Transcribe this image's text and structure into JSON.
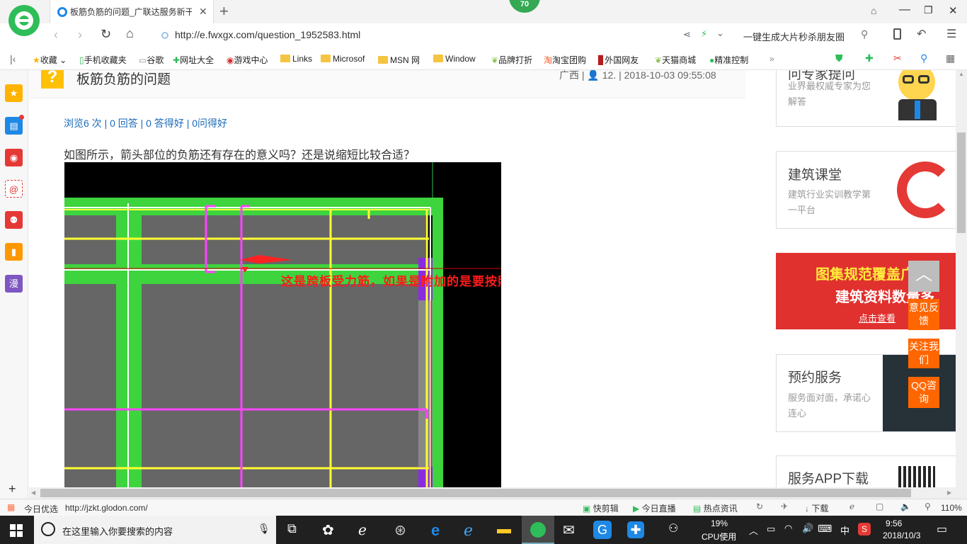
{
  "browser": {
    "tab_title": "板筋负筋的问题_广联达服务新干",
    "badge": "70",
    "url": "http://e.fwxgx.com/question_1952583.html",
    "search_hint": "一键生成大片秒杀朋友圈",
    "bookmarks": [
      "收藏",
      "手机收藏夹",
      "谷歌",
      "网址大全",
      "游戏中心",
      "Links",
      "Microsof",
      "MSN 网",
      "Window",
      "品牌打折",
      "淘宝团购",
      "外国网友",
      "天猫商城",
      "精准控制"
    ]
  },
  "sidebar_left": {
    "comic_label": "漫"
  },
  "question": {
    "title": "板筋负筋的问题",
    "region": "广西",
    "user": "12.",
    "datetime": "2018-10-03 09:55:08",
    "stats": "浏览6 次 | 0 回答 | 0 答得好 | 0问得好",
    "body": "如图所示，箭头部位的负筋还有存在的意义吗？还是说缩短比较合适？",
    "annotation": "这是跨板受力筋，如果是附加的是要按照图纸附加设置的"
  },
  "right_panel": {
    "card1": {
      "title": "问专家提问",
      "sub": "业界最权威专家为您解答"
    },
    "card2": {
      "title": "建筑课堂",
      "sub": "建筑行业实训教学第一平台"
    },
    "banner": {
      "line1": "图集规范覆盖广",
      "line2": "建筑资料数量多",
      "link": "点击查看"
    },
    "card3": {
      "title": "预约服务",
      "sub": "服务面对面，承诺心连心"
    },
    "card4": {
      "title": "服务APP下载"
    }
  },
  "float_buttons": [
    "意见反馈",
    "关注我们",
    "QQ咨询"
  ],
  "statusbar": {
    "left": "今日优选",
    "url": "http://jzkt.glodon.com/",
    "items": [
      "快剪辑",
      "今日直播",
      "热点资讯",
      "下载"
    ],
    "zoom": "110%"
  },
  "taskbar": {
    "search_placeholder": "在这里输入你要搜索的内容",
    "cpu_pct": "19%",
    "cpu_label": "CPU使用",
    "ime": "中",
    "time": "9:56",
    "date": "2018/10/3"
  }
}
